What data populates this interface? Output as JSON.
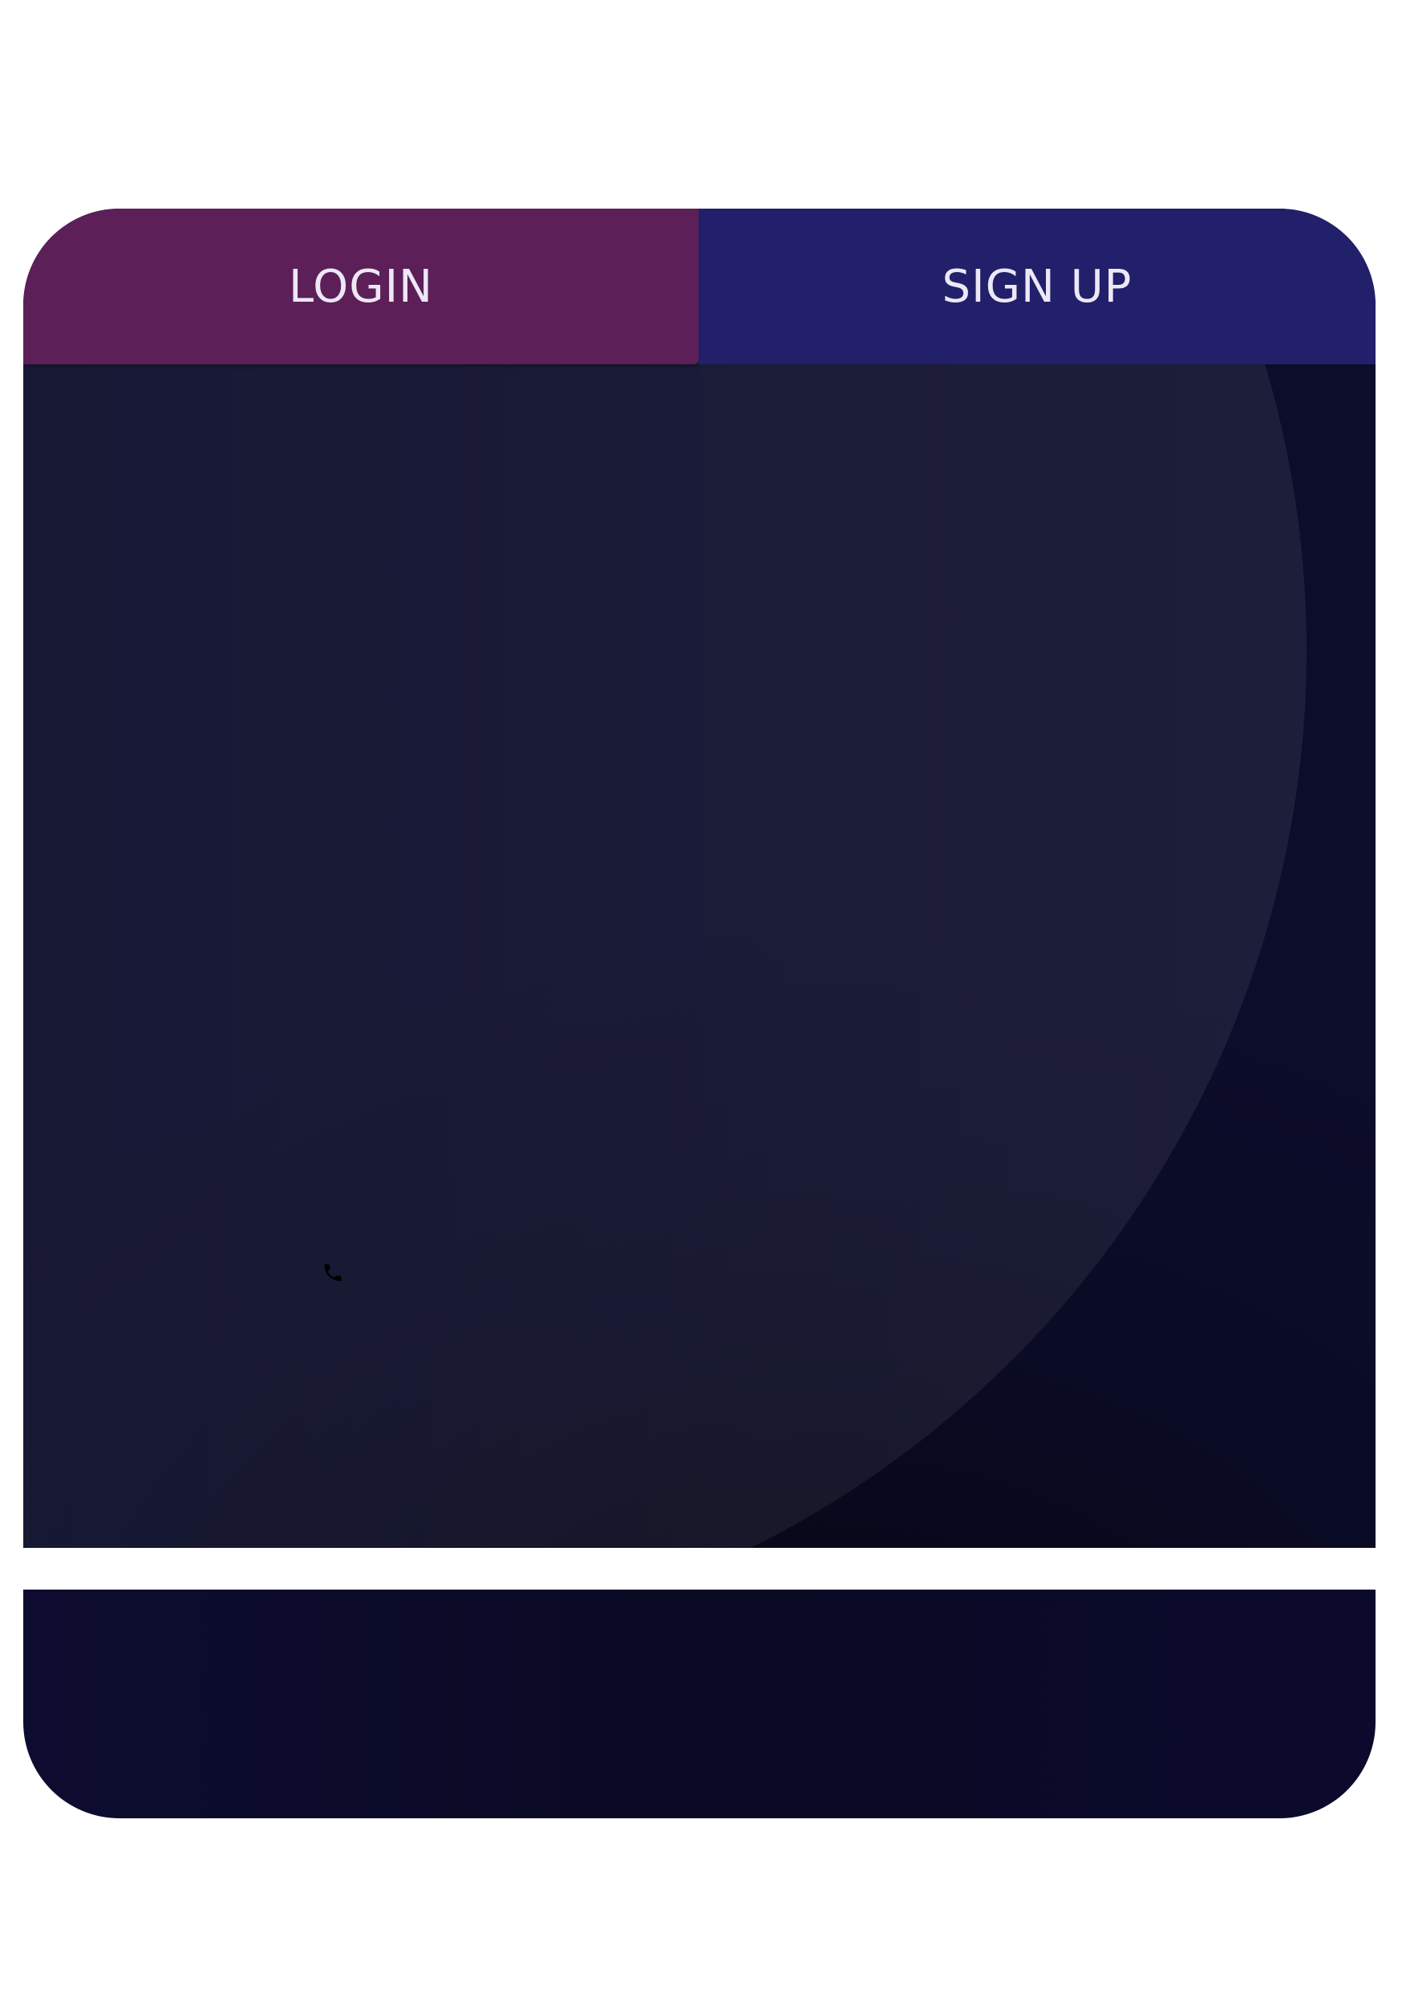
{
  "tabs": {
    "login_label": "LOGIN",
    "signup_label": "SIGN UP"
  },
  "icons": {
    "phone": "phone-icon"
  },
  "colors": {
    "login_tab": "#5d1f58",
    "signup_tab": "#22206a",
    "panel": "#0a0b24"
  }
}
